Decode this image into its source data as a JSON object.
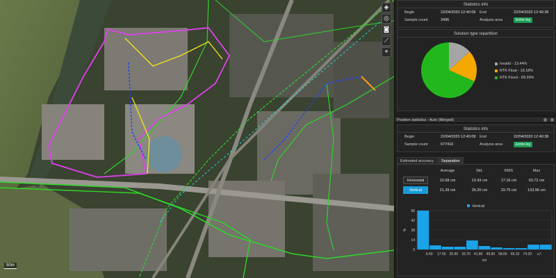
{
  "map": {
    "scale_label": "50m",
    "tools": [
      {
        "icon": "layers-icon",
        "glyph": "◈"
      },
      {
        "icon": "locate-icon",
        "glyph": "◎"
      },
      {
        "icon": "camera-icon",
        "glyph": "◙"
      },
      {
        "icon": "ruler-icon",
        "glyph": "⟋"
      },
      {
        "icon": "marker-icon",
        "glyph": "⌖"
      }
    ]
  },
  "top_stats": {
    "title": "Statistics info",
    "begin_label": "Begin",
    "begin_value": "22/04/2020 12:40:09",
    "end_label": "End",
    "end_value": "22/04/2020 12:40:36",
    "count_label": "Sample count",
    "count_value": "3496",
    "area_label": "Analysis area",
    "area_tag": "Entire log"
  },
  "solution": {
    "title": "Solution type repartition",
    "legend": [
      {
        "label": "Invalid - 13.44%",
        "color": "#a5a5a5",
        "value": 13.44
      },
      {
        "label": "RTK Float - 18.18%",
        "color": "#f5a800",
        "value": 18.18
      },
      {
        "label": "RTK Fixed - 68.39%",
        "color": "#22b81d",
        "value": 68.39
      }
    ]
  },
  "section": {
    "title": "Position statistics - Auto (Merged)"
  },
  "bottom_stats": {
    "title": "Statistics info",
    "begin_label": "Begin",
    "begin_value": "22/04/2020 12:40:09",
    "end_label": "End",
    "end_value": "22/04/2020 12:40:36",
    "count_label": "Sample count",
    "count_value": "677410",
    "area_label": "Analysis area",
    "area_tag": "Entire log"
  },
  "tabs": [
    {
      "label": "Estimated accuracy",
      "active": false
    },
    {
      "label": "Separation",
      "active": true
    }
  ],
  "accuracy_table": {
    "headers": [
      "Average",
      "Std.",
      "RMS",
      "Max"
    ],
    "rows": [
      {
        "label": "Horizontal",
        "values": [
          "10.68 cm",
          "13.43 cm",
          "17.16 cm",
          "63.72 cm"
        ],
        "selected": false
      },
      {
        "label": "Vertical",
        "values": [
          "21.28 cm",
          "26.20 cm",
          "33.75 cm",
          "103.96 cm"
        ],
        "selected": true
      }
    ]
  },
  "chart_data": {
    "type": "bar",
    "legend": "Vertical",
    "series_color": "#1aa3e8",
    "ylabel": "%",
    "xlabel": "cm",
    "y_ticks": [
      "56",
      "42",
      "28",
      "14",
      "0"
    ],
    "ylim": [
      0,
      56
    ],
    "categories": [
      "9.40",
      "17.50",
      "25.60",
      "33.70",
      "41.80",
      "49.90",
      "58.00",
      "66.10",
      "74.20",
      "≥7."
    ],
    "values": [
      56,
      6,
      4,
      4,
      13,
      5,
      3,
      2,
      2,
      7,
      7
    ]
  }
}
